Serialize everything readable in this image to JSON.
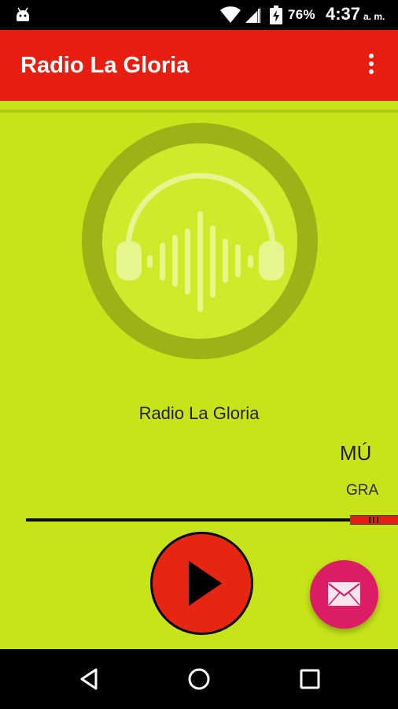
{
  "status_bar": {
    "battery_percent": "76%",
    "time": "4:37",
    "ampm": "a. m.",
    "icons": [
      "android-icon",
      "wifi-icon",
      "signal-icon",
      "battery-charging-icon"
    ]
  },
  "app_bar": {
    "title": "Radio La Gloria",
    "menu_icon": "overflow-menu-icon"
  },
  "player": {
    "station_name": "Radio La Gloria",
    "now_playing_title": "MÚ",
    "now_playing_subtitle": "GRA",
    "artwork_icon": "headphones-waveform-icon",
    "play_icon": "play-icon",
    "contact_icon": "mail-icon"
  },
  "colors": {
    "app_bar": "#e71d10",
    "background": "#c7e41a",
    "play_button": "#e62512",
    "fab": "#dd1c66"
  },
  "nav_bar": {
    "icons": [
      "back-icon",
      "home-icon",
      "recents-icon"
    ]
  }
}
